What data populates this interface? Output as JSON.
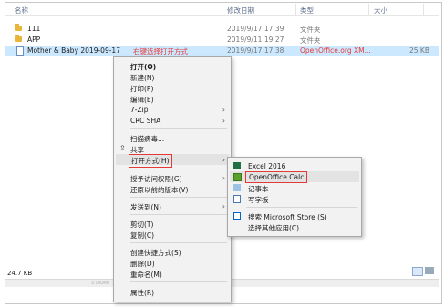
{
  "columns": {
    "name": "名称",
    "date": "修改日期",
    "type": "类型",
    "size": "大小"
  },
  "files": [
    {
      "name": "111",
      "date": "2019/9/17 17:39",
      "type": "文件夹",
      "size": ""
    },
    {
      "name": "APP",
      "date": "2019/9/11 19:27",
      "type": "文件夹",
      "size": ""
    },
    {
      "name": "Mother & Baby 2019-09-17",
      "date": "2019/9/17 17:38",
      "type": "OpenOffice.org XM...",
      "size": "25 KB"
    }
  ],
  "annotation": "右键选择打开方式",
  "context_menu": {
    "open": "打开(O)",
    "new": "新建(N)",
    "print": "打印(P)",
    "edit": "编辑(E)",
    "zip": "7-Zip",
    "crc": "CRC SHA",
    "scan": "扫描病毒...",
    "share": "共享",
    "open_with": "打开方式(H)",
    "grant_access": "授予访问权限(G)",
    "restore": "还原以前的版本(V)",
    "send_to": "发送到(N)",
    "cut": "剪切(T)",
    "copy": "复制(C)",
    "create_shortcut": "创建快捷方式(S)",
    "delete": "删除(D)",
    "rename": "重命名(M)",
    "properties": "属性(R)"
  },
  "submenu": {
    "excel": "Excel 2016",
    "calc": "OpenOffice Calc",
    "notepad": "记事本",
    "wordpad": "写字板",
    "store": "搜索 Microsoft Store (S)",
    "other": "选择其他应用(C)"
  },
  "status": {
    "size": "24.7 KB",
    "tiny": "© LAOMO"
  }
}
